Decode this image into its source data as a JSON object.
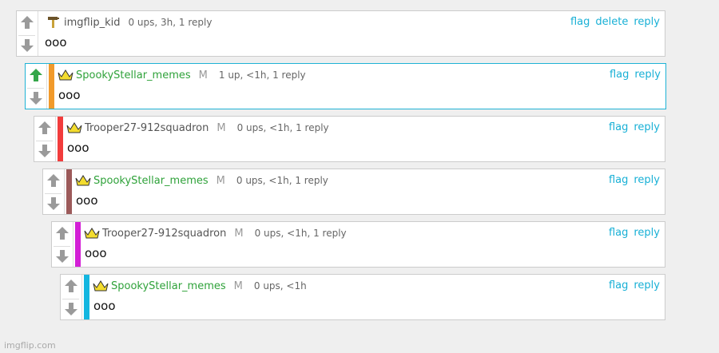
{
  "comments": [
    {
      "icon": "hammer-icon",
      "username": "imgflip_kid",
      "mod": "",
      "meta": "0 ups, 3h, 1 reply",
      "text": "ooo",
      "actions": [
        "flag",
        "delete",
        "reply"
      ],
      "upvoted": false,
      "depth_color": ""
    },
    {
      "icon": "crown-icon",
      "username": "SpookyStellar_memes",
      "mod": "M",
      "meta": "1 up, <1h, 1 reply",
      "text": "ooo",
      "actions": [
        "flag",
        "reply"
      ],
      "upvoted": true,
      "depth_color": "#f19a2b"
    },
    {
      "icon": "crown-icon",
      "username": "Trooper27-912squadron",
      "mod": "M",
      "meta": "0 ups, <1h, 1 reply",
      "text": "ooo",
      "actions": [
        "flag",
        "reply"
      ],
      "upvoted": false,
      "depth_color": "#f23c3c"
    },
    {
      "icon": "crown-icon",
      "username": "SpookyStellar_memes",
      "mod": "M",
      "meta": "0 ups, <1h, 1 reply",
      "text": "ooo",
      "actions": [
        "flag",
        "reply"
      ],
      "upvoted": false,
      "depth_color": "#9c5a5a"
    },
    {
      "icon": "crown-icon",
      "username": "Trooper27-912squadron",
      "mod": "M",
      "meta": "0 ups, <1h, 1 reply",
      "text": "ooo",
      "actions": [
        "flag",
        "reply"
      ],
      "upvoted": false,
      "depth_color": "#d31fd6"
    },
    {
      "icon": "crown-icon",
      "username": "SpookyStellar_memes",
      "mod": "M",
      "meta": "0 ups, <1h",
      "text": "ooo",
      "actions": [
        "flag",
        "reply"
      ],
      "upvoted": false,
      "depth_color": "#13b6e0"
    }
  ],
  "colors": {
    "accent": "#18b0d6",
    "upvote_active": "#35a64a",
    "vote_inactive": "#9a9a9a",
    "username_green": "#2fa23a"
  },
  "footer": {
    "watermark": "imgflip.com"
  }
}
